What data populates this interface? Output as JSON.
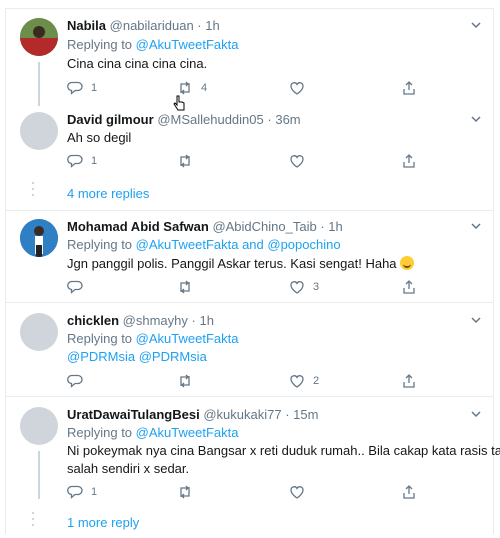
{
  "colors": {
    "link": "#1da1f2",
    "muted": "#657786",
    "text": "#14171a",
    "border": "#e6ecf0"
  },
  "tweets": [
    {
      "name": "Nabila",
      "handle": "@nabilariduan",
      "time": "1h",
      "replying_label": "Replying to",
      "replying_to": "@AkuTweetFakta",
      "text": "Cina cina cina cina cina.",
      "reply_count": "1",
      "retweet_count": "4",
      "like_count": ""
    },
    {
      "name": "David gilmour",
      "handle": "@MSallehuddin05",
      "time": "36m",
      "text": "Ah so degil",
      "reply_count": "1",
      "retweet_count": "",
      "like_count": ""
    },
    {
      "name": "Mohamad Abid Safwan",
      "handle": "@AbidChino_Taib",
      "time": "1h",
      "replying_label": "Replying to",
      "replying_to": "@AkuTweetFakta and @popochino",
      "text": "Jgn panggil polis. Panggil Askar terus. Kasi sengat! Haha",
      "reply_count": "",
      "retweet_count": "",
      "like_count": "3"
    },
    {
      "name": "chicklen",
      "handle": "@shmayhy",
      "time": "1h",
      "replying_label": "Replying to",
      "replying_to": "@AkuTweetFakta",
      "text": "@PDRMsia @PDRMsia",
      "reply_count": "",
      "retweet_count": "",
      "like_count": "2"
    },
    {
      "name": "UratDawaiTulangBesi",
      "handle": "@kukukaki77",
      "time": "15m",
      "replying_label": "Replying to",
      "replying_to": "@AkuTweetFakta",
      "text_line1": "Ni pokeymak nya cina Bangsar x reti duduk rumah.. Bila cakap kata rasis tapi",
      "text_line2": "salah sendiri x sedar.",
      "reply_count": "1",
      "retweet_count": "",
      "like_count": ""
    }
  ],
  "more_replies_1": "4 more replies",
  "more_replies_2": "1 more reply",
  "separator_dot": "·"
}
